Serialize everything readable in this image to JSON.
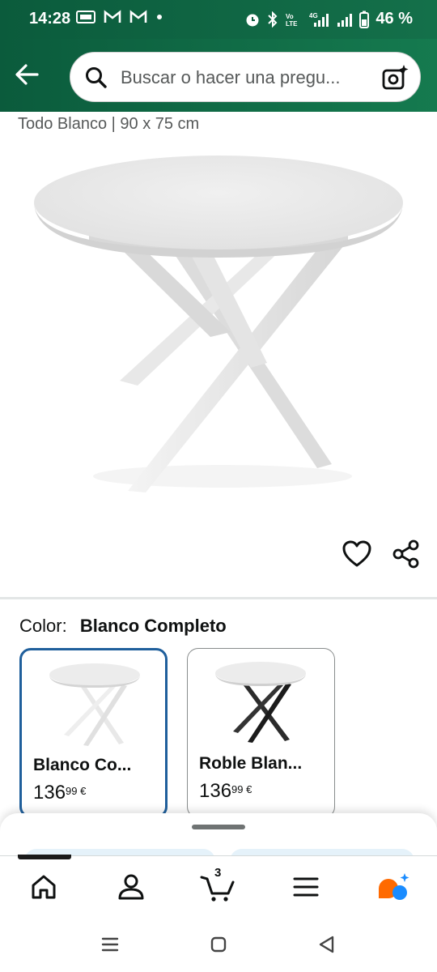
{
  "status_bar": {
    "time": "14:28",
    "battery": "46 %"
  },
  "search": {
    "placeholder": "Buscar o hacer una pregu..."
  },
  "product": {
    "subtitle": "Todo Blanco | 90 x 75 cm"
  },
  "color_selector": {
    "label": "Color:",
    "selected_value": "Blanco Completo",
    "options": [
      {
        "name": "Blanco Co...",
        "price_whole": "136",
        "price_fraction": "99 €",
        "legs_color": "#ffffff",
        "selected": true
      },
      {
        "name": "Roble Blan...",
        "price_whole": "136",
        "price_fraction": "99 €",
        "legs_color": "#1b1b1b",
        "selected": false
      }
    ]
  },
  "bottom_nav": {
    "cart_count": "3",
    "items": [
      "home-icon",
      "account-icon",
      "cart-icon",
      "menu-icon",
      "assistant-icon"
    ]
  },
  "colors": {
    "header_green": "#0b5b3c",
    "selected_border": "#1f5f9c",
    "assistant_orange": "#ff6a00",
    "assistant_blue": "#1a8cff"
  }
}
